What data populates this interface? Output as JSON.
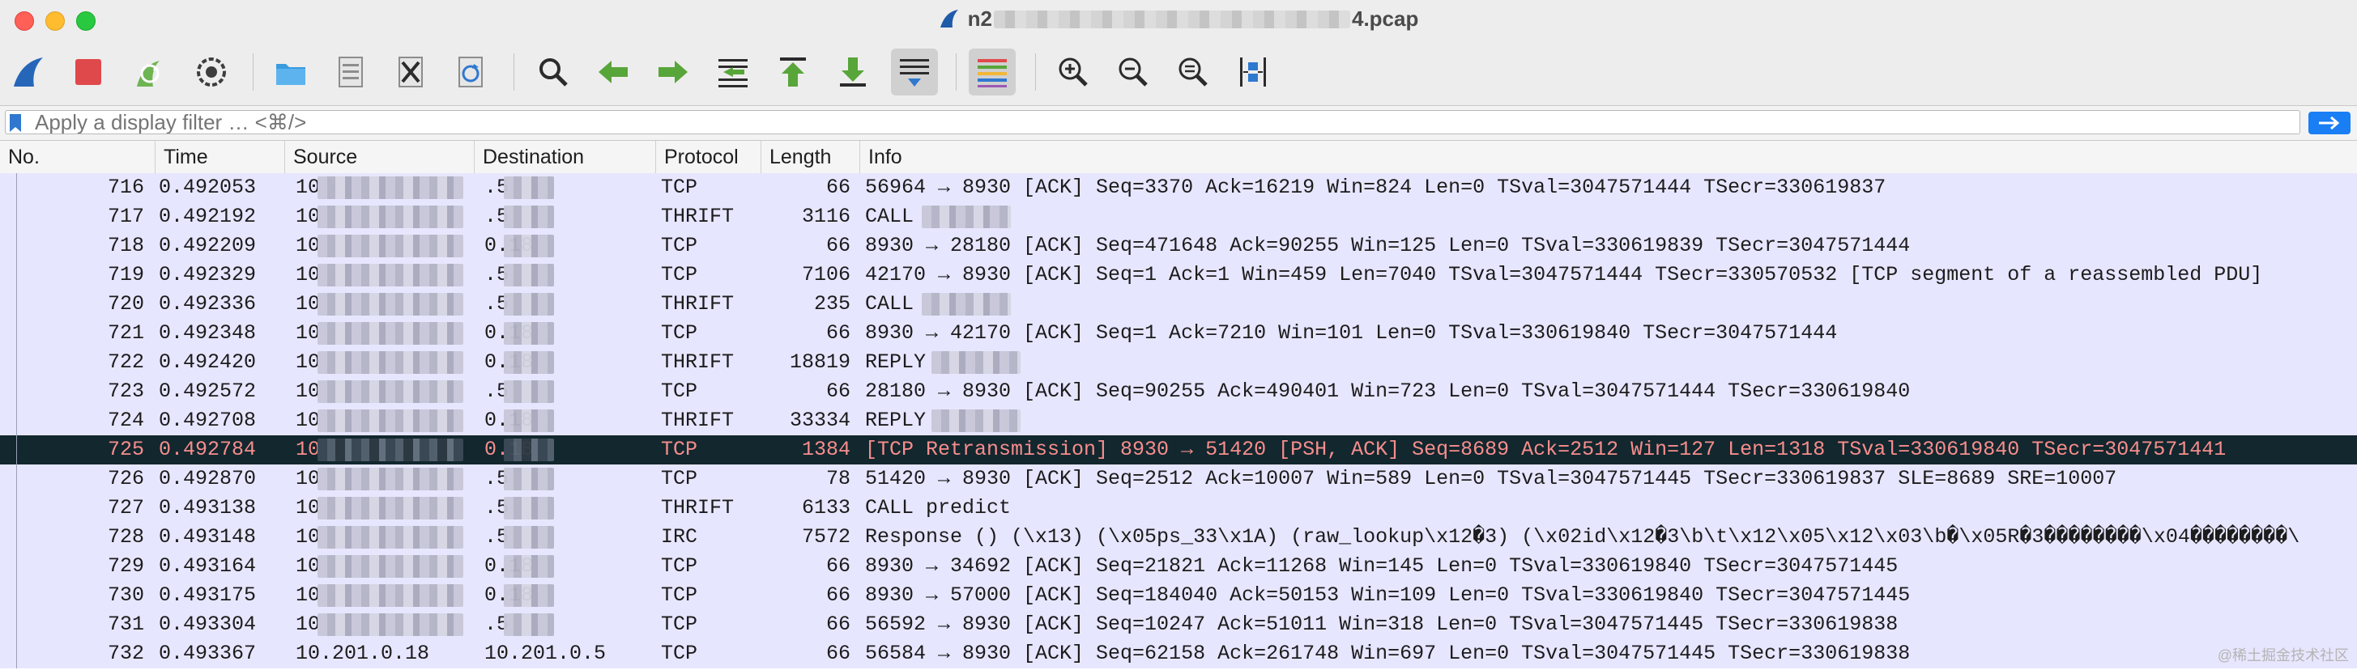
{
  "window": {
    "title_prefix": "n2",
    "title_suffix": "4.pcap"
  },
  "toolbar": {
    "icons": [
      "shark-fin-start-icon",
      "stop-capture-icon",
      "restart-capture-icon",
      "capture-options-icon",
      "open-file-icon",
      "save-file-icon",
      "close-file-icon",
      "reload-file-icon",
      "find-packet-icon",
      "go-back-icon",
      "go-forward-icon",
      "go-to-packet-icon",
      "first-packet-icon",
      "last-packet-icon",
      "autoscroll-icon",
      "colorize-icon",
      "zoom-in-icon",
      "zoom-out-icon",
      "normal-size-icon",
      "resize-columns-icon"
    ]
  },
  "filter": {
    "placeholder": "Apply a display filter … <⌘/>"
  },
  "columns": {
    "no": "No.",
    "time": "Time",
    "source": "Source",
    "destination": "Destination",
    "protocol": "Protocol",
    "length": "Length",
    "info": "Info"
  },
  "packets": [
    {
      "no": "716",
      "time": "0.492053",
      "src": "10",
      "dst": ".5",
      "proto": "TCP",
      "len": "66",
      "info": "56964 → 8930 [ACK] Seq=3370 Ack=16219 Win=824 Len=0 TSval=3047571444 TSecr=330619837"
    },
    {
      "no": "717",
      "time": "0.492192",
      "src": "10",
      "dst": ".5",
      "proto": "THRIFT",
      "len": "3116",
      "info": "CALL"
    },
    {
      "no": "718",
      "time": "0.492209",
      "src": "10",
      "dst": "0.18",
      "proto": "TCP",
      "len": "66",
      "info": "8930 → 28180 [ACK] Seq=471648 Ack=90255 Win=125 Len=0 TSval=330619839 TSecr=3047571444"
    },
    {
      "no": "719",
      "time": "0.492329",
      "src": "10",
      "dst": ".5",
      "proto": "TCP",
      "len": "7106",
      "info": "42170 → 8930 [ACK] Seq=1 Ack=1 Win=459 Len=7040 TSval=3047571444 TSecr=330570532 [TCP segment of a reassembled PDU]"
    },
    {
      "no": "720",
      "time": "0.492336",
      "src": "10",
      "dst": ".5",
      "proto": "THRIFT",
      "len": "235",
      "info": "CALL"
    },
    {
      "no": "721",
      "time": "0.492348",
      "src": "10",
      "dst": "0.18",
      "proto": "TCP",
      "len": "66",
      "info": "8930 → 42170 [ACK] Seq=1 Ack=7210 Win=101 Len=0 TSval=330619840 TSecr=3047571444"
    },
    {
      "no": "722",
      "time": "0.492420",
      "src": "10",
      "dst": "0.18",
      "proto": "THRIFT",
      "len": "18819",
      "info": "REPLY"
    },
    {
      "no": "723",
      "time": "0.492572",
      "src": "10",
      "dst": ".5",
      "proto": "TCP",
      "len": "66",
      "info": "28180 → 8930 [ACK] Seq=90255 Ack=490401 Win=723 Len=0 TSval=3047571444 TSecr=330619840"
    },
    {
      "no": "724",
      "time": "0.492708",
      "src": "10",
      "dst": "0.18",
      "proto": "THRIFT",
      "len": "33334",
      "info": "REPLY"
    },
    {
      "no": "725",
      "time": "0.492784",
      "src": "10",
      "dst": "0.18",
      "proto": "TCP",
      "len": "1384",
      "info": "[TCP Retransmission] 8930 → 51420 [PSH, ACK] Seq=8689 Ack=2512 Win=127 Len=1318 TSval=330619840 TSecr=3047571441"
    },
    {
      "no": "726",
      "time": "0.492870",
      "src": "10",
      "dst": ".5",
      "proto": "TCP",
      "len": "78",
      "info": "51420 → 8930 [ACK] Seq=2512 Ack=10007 Win=589 Len=0 TSval=3047571445 TSecr=330619837 SLE=8689 SRE=10007"
    },
    {
      "no": "727",
      "time": "0.493138",
      "src": "10",
      "dst": ".5",
      "proto": "THRIFT",
      "len": "6133",
      "info": "CALL predict"
    },
    {
      "no": "728",
      "time": "0.493148",
      "src": "10",
      "dst": ".5",
      "proto": "IRC",
      "len": "7572",
      "info": "Response () (\\x13) (\\x05ps_33\\x1A) (raw_lookup\\x12�3) (\\x02id\\x12�3\\b\\t\\x12\\x05\\x12\\x03\\b�\\x05R�3��������\\x04��������\\"
    },
    {
      "no": "729",
      "time": "0.493164",
      "src": "10",
      "dst": "0.18",
      "proto": "TCP",
      "len": "66",
      "info": "8930 → 34692 [ACK] Seq=21821 Ack=11268 Win=145 Len=0 TSval=330619840 TSecr=3047571445"
    },
    {
      "no": "730",
      "time": "0.493175",
      "src": "10",
      "dst": "0.18",
      "proto": "TCP",
      "len": "66",
      "info": "8930 → 57000 [ACK] Seq=184040 Ack=50153 Win=109 Len=0 TSval=330619840 TSecr=3047571445"
    },
    {
      "no": "731",
      "time": "0.493304",
      "src": "10",
      "dst": ".5",
      "proto": "TCP",
      "len": "66",
      "info": "56592 → 8930 [ACK] Seq=10247 Ack=51011 Win=318 Len=0 TSval=3047571445 TSecr=330619838"
    },
    {
      "no": "732",
      "time": "0.493367",
      "src": "10.201.0.18",
      "dst": "10.201.0.5",
      "proto": "TCP",
      "len": "66",
      "info": "56584 → 8930 [ACK] Seq=62158 Ack=261748 Win=697 Len=0 TSval=3047571445 TSecr=330619838"
    }
  ],
  "selected_row_no": "725",
  "watermark": "@稀土掘金技术社区",
  "colors": {
    "row_bg": "#e7e6ff",
    "selected_bg": "#12272e",
    "selected_text": "#f78d8d",
    "accent": "#1a7ef4"
  }
}
